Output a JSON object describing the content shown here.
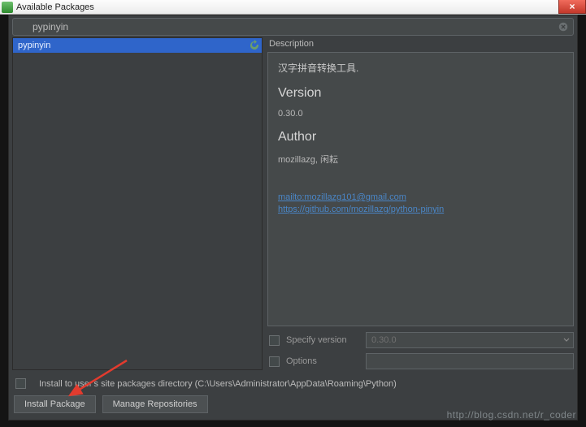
{
  "window": {
    "title": "Available Packages",
    "close_label": "×"
  },
  "search": {
    "value": "pypinyin"
  },
  "results": {
    "items": [
      {
        "name": "pypinyin",
        "selected": true
      }
    ]
  },
  "description": {
    "label": "Description",
    "summary": "汉字拼音转换工具.",
    "version_heading": "Version",
    "version": "0.30.0",
    "author_heading": "Author",
    "author": "mozillazg, 闲耘",
    "links": [
      "mailto:mozillazg101@gmail.com",
      "https://github.com/mozillazg/python-pinyin"
    ]
  },
  "options": {
    "specify_version_label": "Specify version",
    "specify_version_value": "0.30.0",
    "options_label": "Options",
    "options_value": ""
  },
  "footer": {
    "install_to_user_site": "Install to user's site packages directory (C:\\Users\\Administrator\\AppData\\Roaming\\Python)",
    "install_button": "Install Package",
    "manage_button": "Manage Repositories"
  },
  "watermark": "http://blog.csdn.net/r_coder"
}
